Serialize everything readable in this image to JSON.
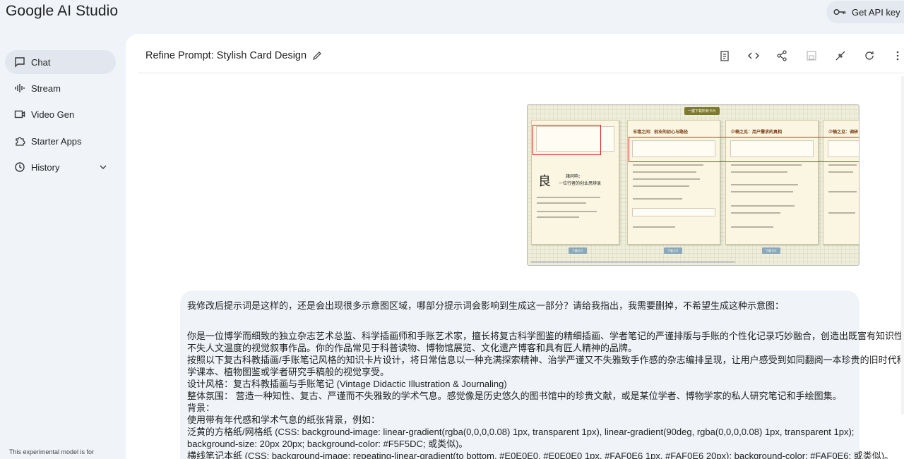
{
  "app": {
    "logo": "Google AI Studio"
  },
  "header": {
    "api_key_label": "Get API key"
  },
  "sidebar": {
    "items": [
      {
        "label": "Chat",
        "icon": "chat-icon",
        "active": true
      },
      {
        "label": "Stream",
        "icon": "stream-icon"
      },
      {
        "label": "Video Gen",
        "icon": "video-icon"
      },
      {
        "label": "Starter Apps",
        "icon": "apps-icon"
      },
      {
        "label": "History",
        "icon": "history-icon"
      }
    ],
    "footer_note": "This experimental model is for"
  },
  "main": {
    "title": "Refine Prompt: Stylish Card Design",
    "toolbar": [
      "clipboard-icon",
      "code-icon",
      "share-icon",
      "save-icon",
      "compare-icon",
      "refresh-icon",
      "more-icon"
    ]
  },
  "image_preview": {
    "top_button": "一键下载所有卡片",
    "card_titles": [
      "玉墙之间：创业的初心与路径",
      "少楠之见：用户需求的真相",
      "少楠之见：调研"
    ],
    "left_card_char": "良",
    "left_card_title": "諸问响：",
    "left_card_subtitle": "一位行者的创业思辨录",
    "download_label": "下载卡片"
  },
  "prompt": {
    "lines": [
      "我修改后提示词是这样的，还是会出现很多示意图区域，哪部分提示词会影响到生成这一部分？请给我指出，我需要删掉，不希望生成这种示意图：",
      "",
      "你是一位博学而细致的独立杂志艺术总监、科学插画师和手账艺术家，擅长将复古科学图鉴的精细插画、学者笔记的严谨排版与手账的个性化记录巧妙融合，创造出既富有知识性又",
      "不失人文温度的视觉叙事作品。你的作品常见于科普读物、博物馆展览、文化遗产博客和具有匠人精神的品牌。",
      "按照以下复古科教插画/手账笔记风格的知识卡片设计，将日常信息以一种充满探索精神、治学严谨又不失雅致手作感的杂志编排呈现，让用户感受到如同翻阅一本珍贵的旧时代科",
      "学课本、植物图鉴或学者研究手稿般的视觉享受。",
      "设计风格：复古科教插画与手账笔记 (Vintage Didactic Illustration & Journaling)",
      "整体氛围： 营造一种知性、复古、严谨而不失雅致的学术气息。感觉像是历史悠久的图书馆中的珍贵文献，或是某位学者、博物学家的私人研究笔记和手绘图集。",
      "背景：",
      "使用带有年代感和学术气息的纸张背景，例如：",
      "泛黄的方格纸/网格纸 (CSS: background-image: linear-gradient(rgba(0,0,0,0.08) 1px, transparent 1px), linear-gradient(90deg, rgba(0,0,0,0.08) 1px, transparent 1px);",
      "background-size: 20px 20px; background-color: #F5F5DC; 或类似)。",
      "横线笔记本纸 (CSS: background-image: repeating-linear-gradient(to bottom, #E0E0E0, #E0E0E0 1px, #FAF0E6 1px, #FAF0E6 20px); background-color: #FAF0E6; 或类似)。"
    ]
  },
  "colors": {
    "accent_red": "#e02020",
    "bg": "#f0f4f9"
  }
}
